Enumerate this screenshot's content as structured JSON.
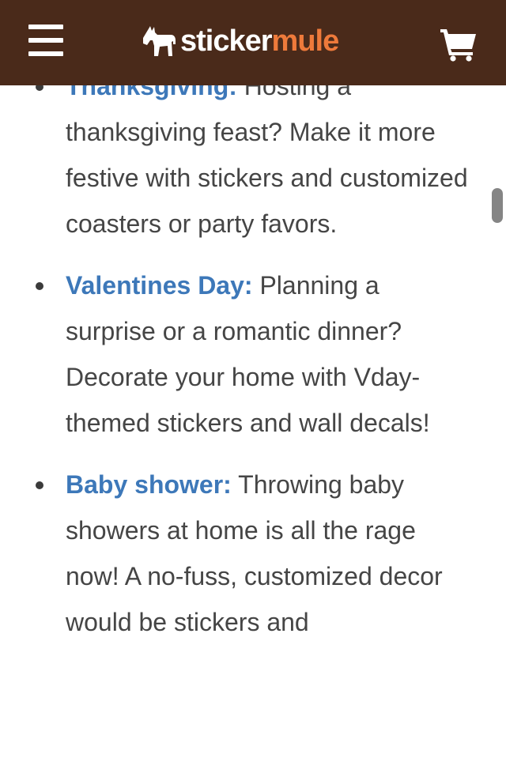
{
  "header": {
    "logo_part1": "sticker",
    "logo_part2": "mule",
    "menu_icon": "hamburger-menu-icon",
    "logo_icon": "mule-icon",
    "cart_icon": "shopping-cart-icon",
    "background_color": "#4a2a1a",
    "accent_color": "#ee7a3b"
  },
  "occasions": [
    {
      "term": "Thanksgiving:",
      "text": " Hosting a thanksgiving feast? Make it more festive with stickers and customized coasters or party favors."
    },
    {
      "term": "Valentines Day:",
      "text": " Planning a surprise or a romantic dinner? Decorate your home with Vday-themed stickers and wall decals!"
    },
    {
      "term": "Baby shower:",
      "text": " Throwing baby showers at home is all the rage now! A no-fuss, customized decor would be stickers and"
    }
  ],
  "colors": {
    "term_link": "#3d78b9",
    "body_text": "#454545"
  }
}
